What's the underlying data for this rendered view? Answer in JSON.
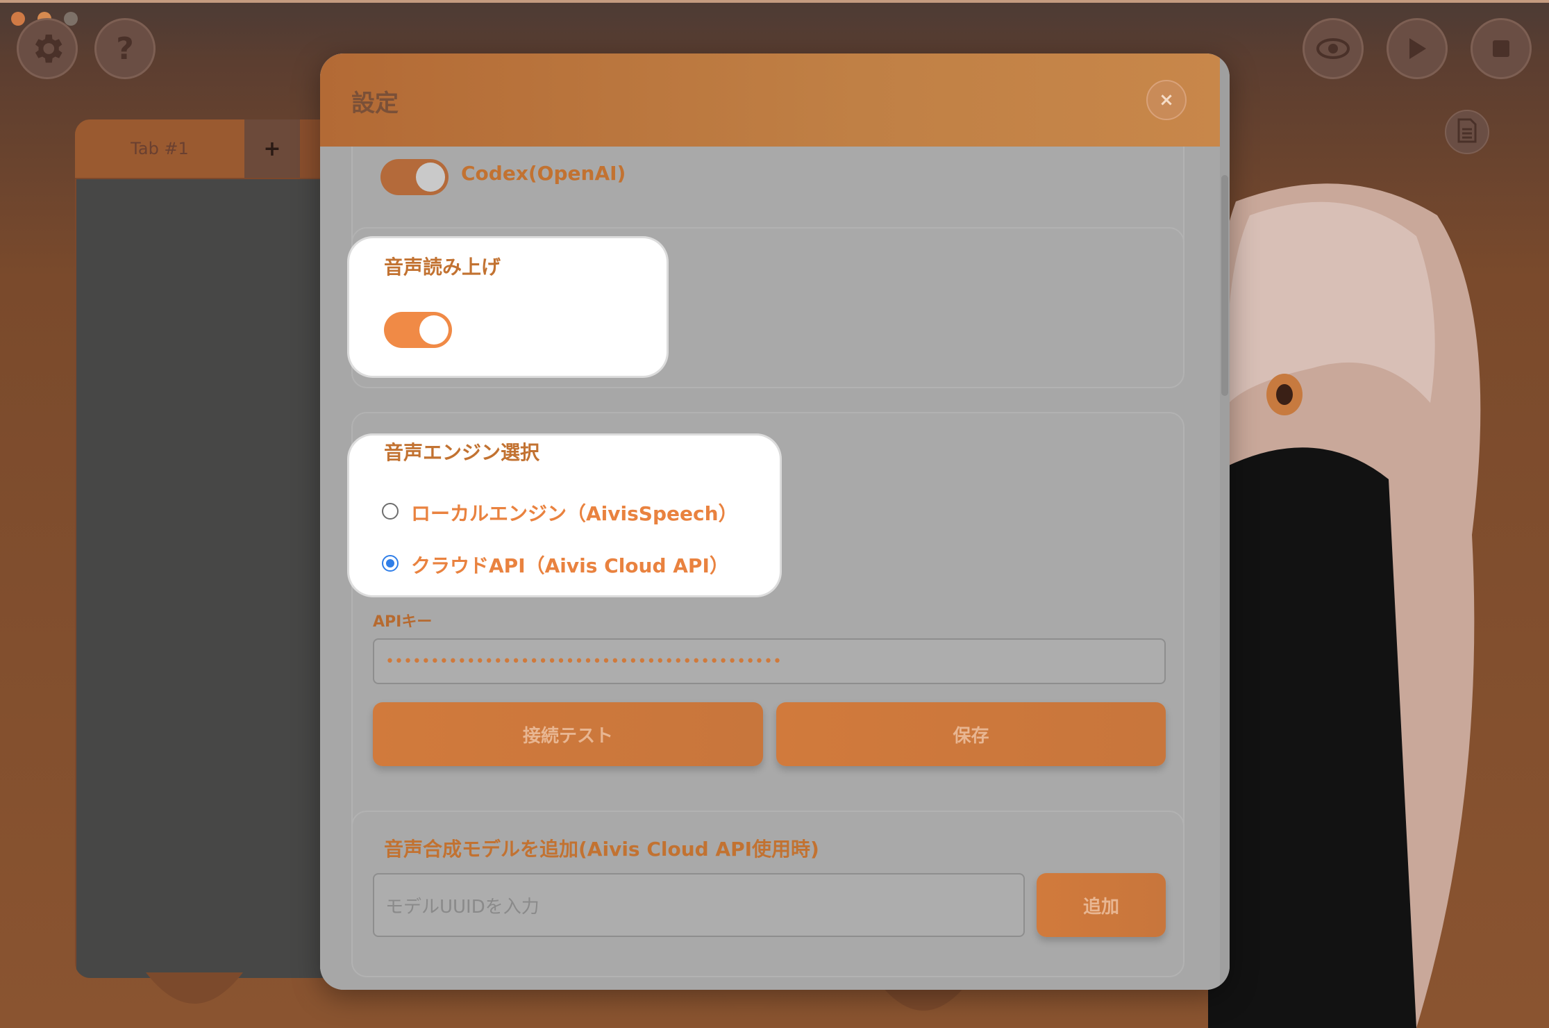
{
  "window": {
    "title": "設定"
  },
  "toolbar_left": {
    "settings_icon": "gear-icon",
    "help_icon": "question-icon",
    "help_glyph": "?"
  },
  "toolbar_right": {
    "preview_icon": "eye-icon",
    "play_icon": "play-icon",
    "stop_icon": "stop-icon",
    "document_icon": "document-icon"
  },
  "tabs": {
    "items": [
      {
        "label": "Tab #1"
      }
    ],
    "add_label": "+"
  },
  "modal": {
    "title": "設定",
    "close_label": "×",
    "previous_option_label": "Codex(OpenAI)",
    "tts_section": {
      "label": "音声読み上げ",
      "toggle_on": true
    },
    "engine_section": {
      "label": "音声エンジン選択",
      "options": [
        {
          "label": "ローカルエンジン（AivisSpeech）",
          "selected": false
        },
        {
          "label": "クラウドAPI（Aivis Cloud API）",
          "selected": true
        }
      ],
      "api_key_label": "APIキー",
      "api_key_value": "••••••••••••••••••••••••••••••••••••••••••••",
      "test_button": "接続テスト",
      "save_button": "保存"
    },
    "model_section": {
      "label": "音声合成モデルを追加(Aivis Cloud API使用時)",
      "input_placeholder": "モデルUUIDを入力",
      "add_button": "追加"
    }
  },
  "colors": {
    "accent": "#f08a46",
    "label_orange": "#c27231",
    "radio_blue": "#2f7ee8"
  }
}
